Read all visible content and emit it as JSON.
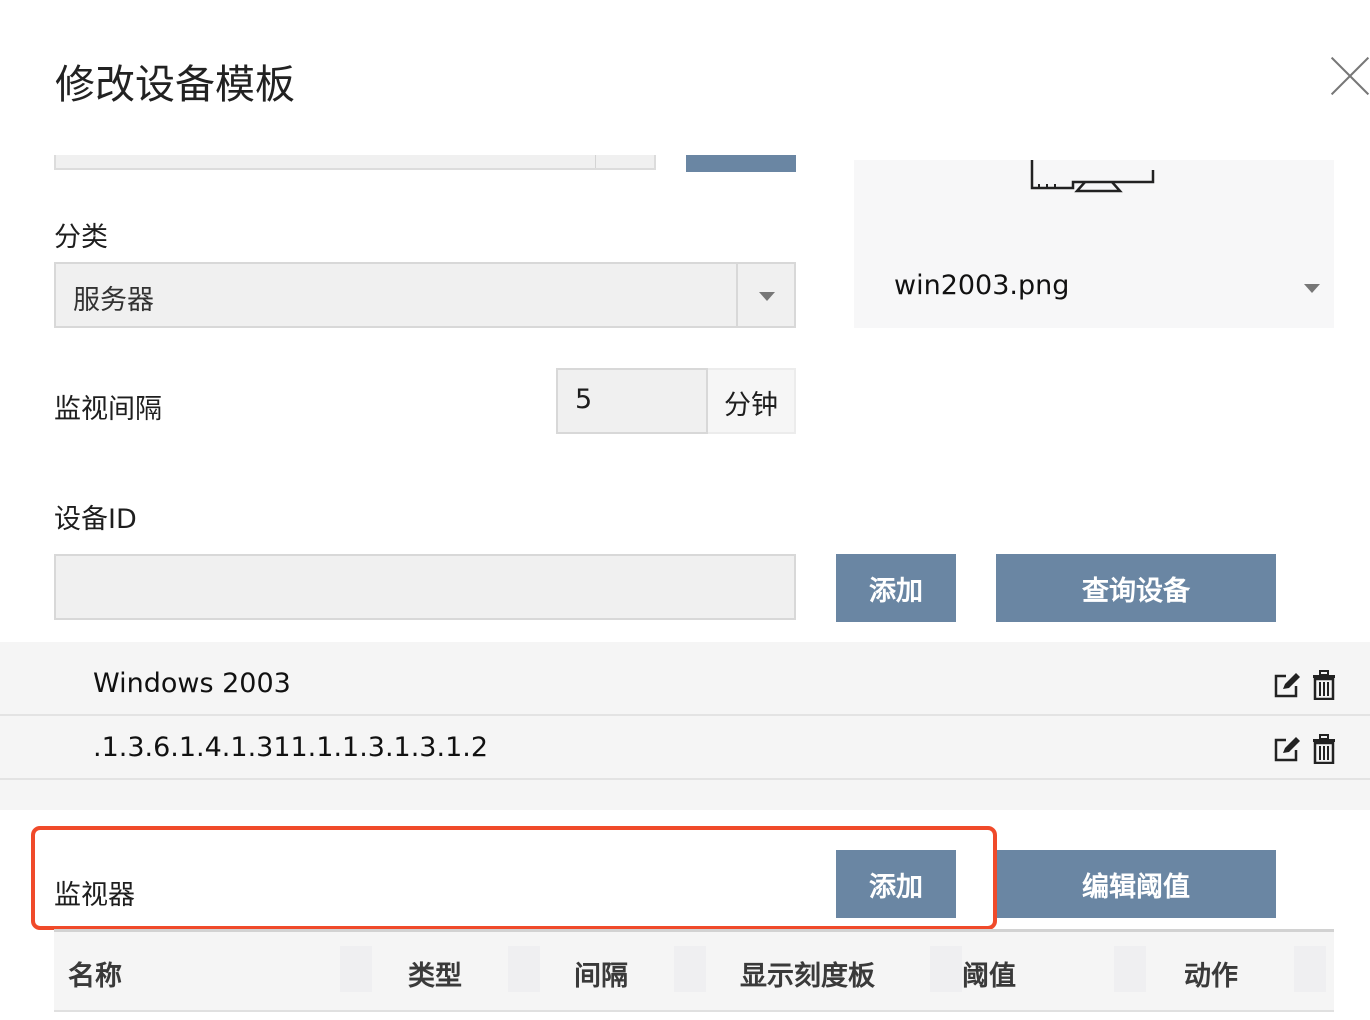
{
  "dialog": {
    "title": "修改设备模板"
  },
  "category": {
    "label": "分类",
    "value": "服务器"
  },
  "image": {
    "filename": "win2003.png"
  },
  "interval": {
    "label": "监视间隔",
    "value": "5",
    "unit": "分钟"
  },
  "device_id": {
    "label": "设备ID",
    "value": "",
    "add_label": "添加",
    "query_label": "查询设备",
    "entries": [
      {
        "text": "Windows 2003"
      },
      {
        "text": ".1.3.6.1.4.1.311.1.1.3.1.3.1.2"
      }
    ]
  },
  "monitors": {
    "label": "监视器",
    "add_label": "添加",
    "edit_threshold_label": "编辑阈值",
    "columns": [
      "名称",
      "类型",
      "间隔",
      "显示刻度板",
      "阈值",
      "动作"
    ]
  },
  "colors": {
    "button": "#6a86a3",
    "highlight": "#f04a2a"
  },
  "icons": [
    "close-icon",
    "monitor-icon",
    "chevron-down-icon",
    "edit-icon",
    "trash-icon"
  ]
}
